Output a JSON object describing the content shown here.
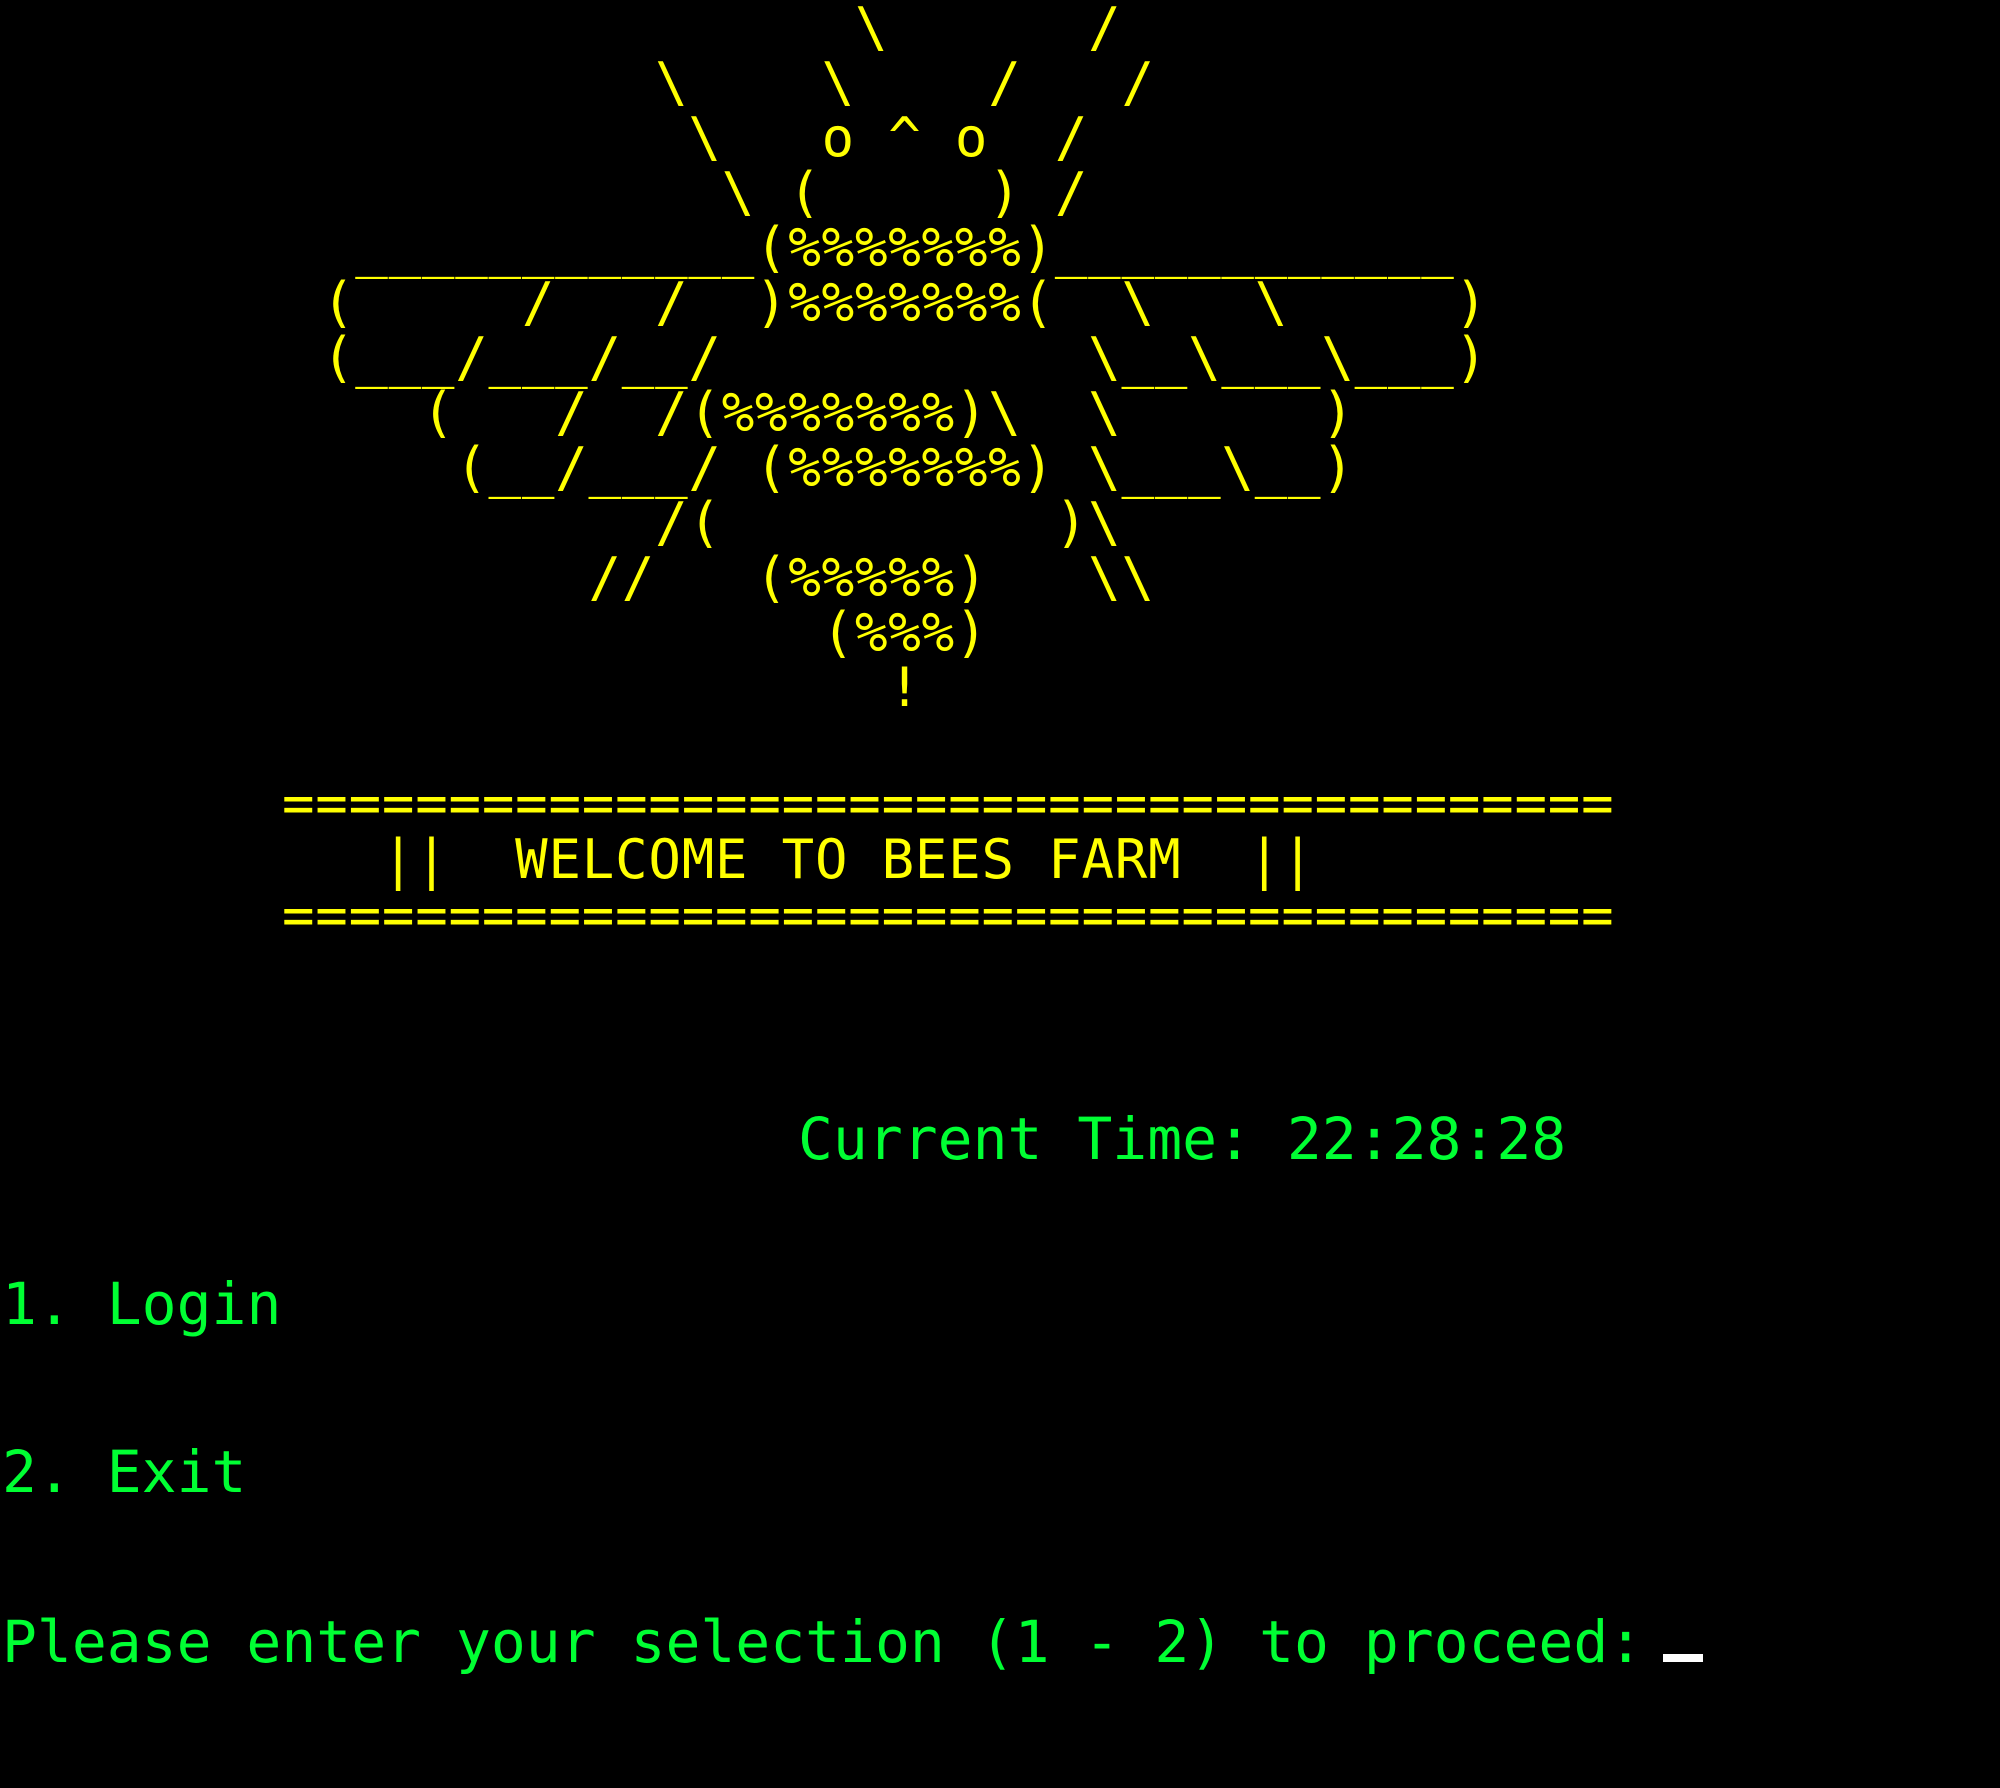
{
  "bee_ascii_art": "                \\      /\n          \\    \\    /   /\n           \\   o ^ o  /\n            \\ (     ) /\n ____________(%%%%%%%)____________\n(     /   /  )%%%%%%%(  \\   \\     )\n(___/___/__/           \\__\\___\\___)\n   (   /  /(%%%%%%%)\\  \\      )\n    (__/___/ (%%%%%%%) \\___\\__)\n          /(          )\\\n        //   (%%%%%)   \\\\\n               (%%%)\n                 !",
  "banner": {
    "rule_top": "========================================",
    "title": "   ||  WELCOME TO BEES FARM  ||",
    "rule_bottom": "========================================"
  },
  "clock": {
    "label": "Current Time:",
    "value": "22:28:28"
  },
  "menu": {
    "items": [
      {
        "number": "1.",
        "label": "Login"
      },
      {
        "number": "2.",
        "label": "Exit"
      }
    ],
    "prompt": "Please enter your selection (1 - 2) to proceed:"
  },
  "colors": {
    "background": "#000000",
    "art": "#ffff00",
    "text": "#00ff33",
    "cursor": "#ffffff"
  }
}
